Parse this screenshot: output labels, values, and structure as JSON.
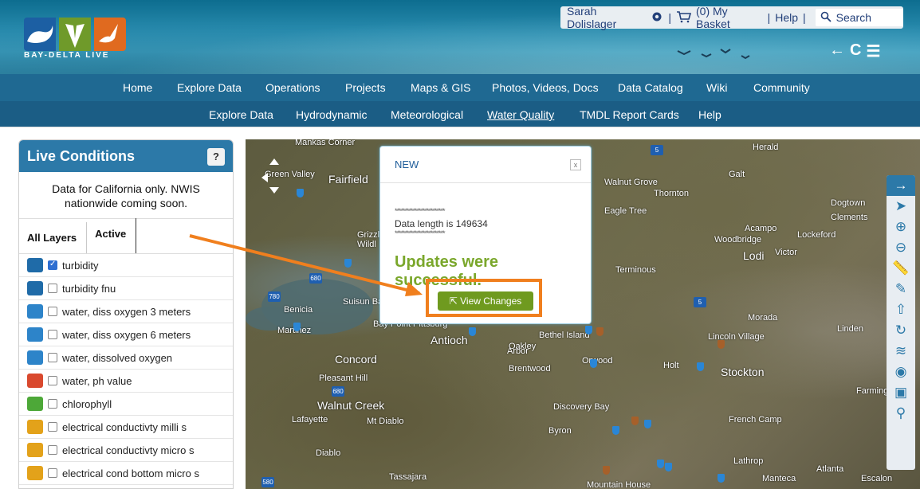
{
  "header": {
    "logo_text": "BAY-DELTA LIVE",
    "user_name": "Sarah Dolislager",
    "basket": "(0) My Basket",
    "help": "Help",
    "search_placeholder": "Search",
    "tools": [
      "←",
      "C",
      "☰"
    ]
  },
  "nav_main": [
    "Home",
    "Explore Data",
    "Operations",
    "Projects",
    "Maps & GIS",
    "Photos, Videos, Docs",
    "Data Catalog",
    "Wiki",
    "Community"
  ],
  "nav_sub": [
    "Explore Data",
    "Hydrodynamic",
    "Meteorological",
    "Water Quality",
    "TMDL Report Cards",
    "Help"
  ],
  "nav_sub_active": "Water Quality",
  "panel": {
    "title": "Live Conditions",
    "help": "?",
    "note": "Data for California only. NWIS nationwide coming soon.",
    "tab_all": "All Layers",
    "tab_active": "Active",
    "layers": [
      {
        "label": "turbidity",
        "checked": true,
        "color": "#1f6ba8"
      },
      {
        "label": "turbidity fnu",
        "checked": false,
        "color": "#1f6ba8"
      },
      {
        "label": "water, diss oxygen 3 meters",
        "checked": false,
        "color": "#2d84c9"
      },
      {
        "label": "water, diss oxygen 6 meters",
        "checked": false,
        "color": "#2d84c9"
      },
      {
        "label": "water, dissolved oxygen",
        "checked": false,
        "color": "#2d84c9"
      },
      {
        "label": "water, ph value",
        "checked": false,
        "color": "#d9492e"
      },
      {
        "label": "chlorophyll",
        "checked": false,
        "color": "#4da838"
      },
      {
        "label": "electrical conductivty milli s",
        "checked": false,
        "color": "#e3a21a"
      },
      {
        "label": "electrical conductivty micro s",
        "checked": false,
        "color": "#e3a21a"
      },
      {
        "label": "electrical cond bottom micro s",
        "checked": false,
        "color": "#e3a21a"
      }
    ]
  },
  "map": {
    "labels": [
      "Mankas Corner",
      "Green Valley",
      "Fairfield",
      "Grizzly",
      "Wildl",
      "Suisun Bay",
      "Benicia",
      "Martinez",
      "Bay Point",
      "Pittsburg",
      "Antioch",
      "Oakley",
      "Concord",
      "Pleasant Hill",
      "Walnut Creek",
      "Lafayette",
      "Mt Diablo",
      "Diablo",
      "Tassajara",
      "Walnut Grove",
      "Thornton",
      "Eagle Tree",
      "Terminous",
      "Bethel Island",
      "Brentwood",
      "Orwood",
      "Discovery Bay",
      "Byron",
      "Galt",
      "Herald",
      "Acampo",
      "Woodbridge",
      "Lodi",
      "Victor",
      "Lockeford",
      "Dogtown",
      "Clements",
      "Morada",
      "Linden",
      "Lincoln Village",
      "Stockton",
      "Holt",
      "French Camp",
      "Lathrop",
      "Manteca",
      "Atlanta",
      "Escalon",
      "Farmington",
      "Mountain House",
      "Arbor"
    ],
    "highways": [
      "5",
      "680",
      "780",
      "680",
      "5",
      "580"
    ]
  },
  "popup": {
    "title": "NEW",
    "close": "x",
    "stars": "*************************",
    "data_length": "Data length is 149634",
    "success": "Updates were successful.",
    "button": "View Changes"
  }
}
